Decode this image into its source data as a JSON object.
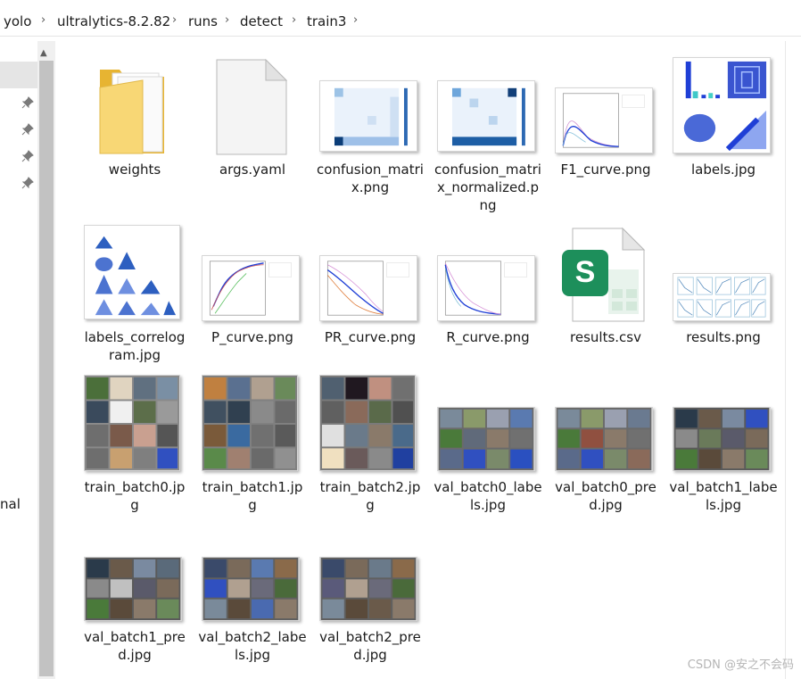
{
  "breadcrumb": {
    "items": [
      "yolo",
      "ultralytics-8.2.82",
      "runs",
      "detect",
      "train3"
    ]
  },
  "nav": {
    "partial_label": "nal"
  },
  "files": [
    {
      "name": "weights",
      "icon": "folder-icon"
    },
    {
      "name": "args.yaml",
      "icon": "document-icon"
    },
    {
      "name": "confusion_matri\nx.png",
      "icon": "confusion-matrix-thumbnail"
    },
    {
      "name": "confusion_matri\nx_normalized.p\nng",
      "icon": "confusion-matrix-normalized-thumbnail"
    },
    {
      "name": "F1_curve.png",
      "icon": "f1-curve-thumbnail"
    },
    {
      "name": "labels.jpg",
      "icon": "labels-thumbnail"
    },
    {
      "name": "labels_correlog\nram.jpg",
      "icon": "correlogram-thumbnail"
    },
    {
      "name": "P_curve.png",
      "icon": "p-curve-thumbnail"
    },
    {
      "name": "PR_curve.png",
      "icon": "pr-curve-thumbnail"
    },
    {
      "name": "R_curve.png",
      "icon": "r-curve-thumbnail"
    },
    {
      "name": "results.csv",
      "icon": "spreadsheet-icon"
    },
    {
      "name": "results.png",
      "icon": "results-thumbnail"
    },
    {
      "name": "train_batch0.jp\ng",
      "icon": "image-mosaic-thumbnail"
    },
    {
      "name": "train_batch1.jp\ng",
      "icon": "image-mosaic-thumbnail"
    },
    {
      "name": "train_batch2.jp\ng",
      "icon": "image-mosaic-thumbnail"
    },
    {
      "name": "val_batch0_labe\nls.jpg",
      "icon": "image-mosaic-thumbnail"
    },
    {
      "name": "val_batch0_pre\nd.jpg",
      "icon": "image-mosaic-thumbnail"
    },
    {
      "name": "val_batch1_labe\nls.jpg",
      "icon": "image-mosaic-thumbnail"
    },
    {
      "name": "val_batch1_pre\nd.jpg",
      "icon": "image-mosaic-thumbnail"
    },
    {
      "name": "val_batch2_labe\nls.jpg",
      "icon": "image-mosaic-thumbnail"
    },
    {
      "name": "val_batch2_pre\nd.jpg",
      "icon": "image-mosaic-thumbnail"
    }
  ],
  "watermark": "CSDN @安之不会码",
  "colors": {
    "folder": "#f3c54d",
    "spreadsheet_green": "#1d8f5b",
    "plot_blue": "#1f3fd6",
    "selection": "#cce8ff"
  }
}
